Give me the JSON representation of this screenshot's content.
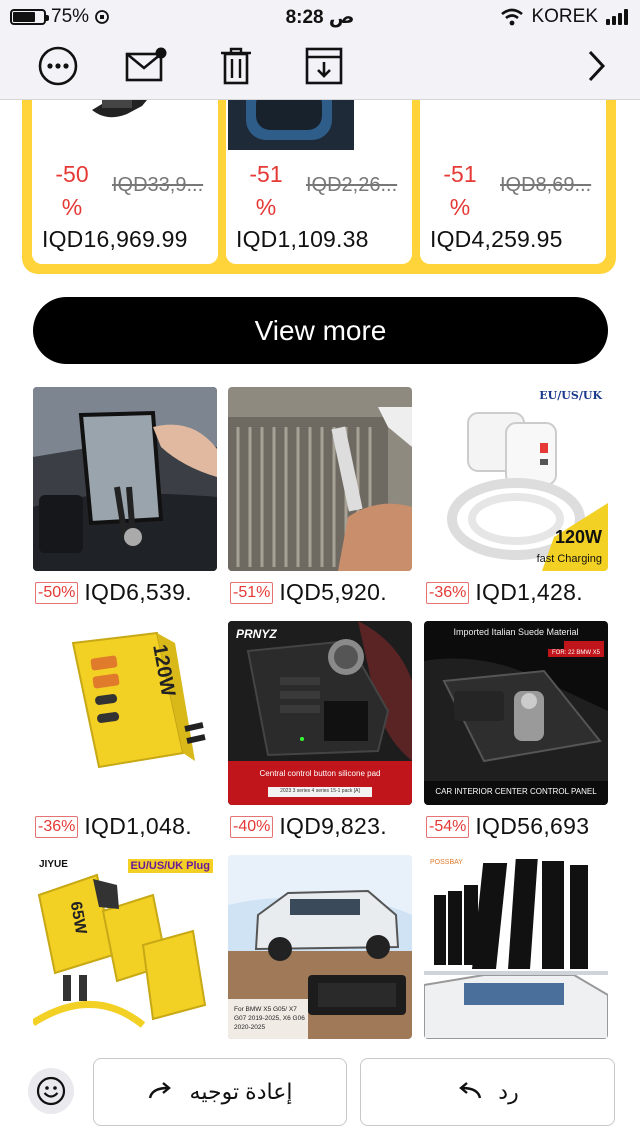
{
  "status_bar": {
    "battery": "75%",
    "time": "8:28 ص",
    "carrier": "KOREK"
  },
  "toolbar": {
    "icons": [
      "more-icon",
      "mail-unread-icon",
      "trash-icon",
      "archive-icon",
      "chevron-right-icon"
    ]
  },
  "deals": [
    {
      "discount": "-50 %",
      "original": "IQD33,9...",
      "price": "IQD16,969.99"
    },
    {
      "discount": "-51 %",
      "original": "IQD2,26...",
      "price": "IQD1,109.38"
    },
    {
      "discount": "-51 %",
      "original": "IQD8,69...",
      "price": "IQD4,259.95"
    }
  ],
  "view_more": "View more",
  "products": [
    {
      "discount": "-50%",
      "price": "IQD6,539."
    },
    {
      "discount": "-51%",
      "price": "IQD5,920."
    },
    {
      "discount": "-36%",
      "price": "IQD1,428.",
      "image_text": [
        "EU/US/UK",
        "120W",
        "fast Charging"
      ]
    },
    {
      "discount": "-36%",
      "price": "IQD1,048.",
      "image_text": [
        "120W"
      ]
    },
    {
      "discount": "-40%",
      "price": "IQD9,823.",
      "image_text": [
        "PRNYZ",
        "Central control button silicone pad",
        "2023 3 series 4 series 15-1 pack [A]"
      ]
    },
    {
      "discount": "-54%",
      "price": "IQD56,693",
      "image_text": [
        "Imported Italian Suede Material",
        "FOR: 22 BMW X5",
        "CAR INTERIOR CENTER CONTROL PANEL"
      ]
    },
    {
      "image_text": [
        "JIYUE",
        "EU/US/UK Plug",
        "65W"
      ]
    },
    {
      "image_text": [
        "For BMW X5 G05/ X7",
        "G07 2019-2025, X6 G06",
        "2020-2025"
      ]
    },
    {
      "image_text": [
        "POSSBAY"
      ]
    }
  ],
  "bottom_bar": {
    "forward_label": "إعادة توجيه",
    "reply_label": "رد"
  },
  "colors": {
    "deal_bg": "#ffd43b",
    "discount": "#e53935",
    "button_bg": "#000000"
  }
}
